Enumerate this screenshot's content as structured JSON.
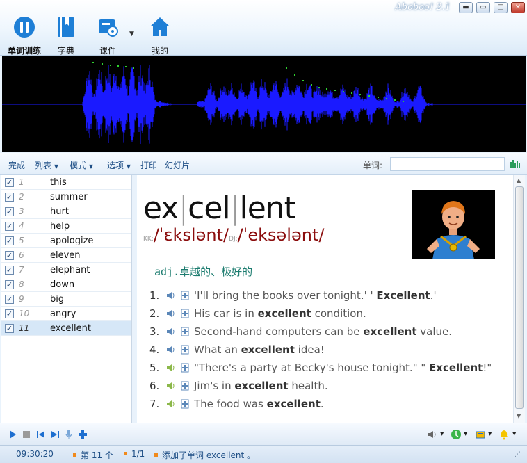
{
  "app": {
    "title": "Aboboo! 2.1"
  },
  "toolbar": {
    "buttons": [
      {
        "label": "单词训练",
        "icon": "pause-circle-icon"
      },
      {
        "label": "字典",
        "icon": "book-icon"
      },
      {
        "label": "课件",
        "icon": "courseware-icon"
      },
      {
        "label": "我的",
        "icon": "home-icon"
      }
    ]
  },
  "actionbar": {
    "done": "完成",
    "list": "列表",
    "mode": "模式",
    "options": "选项",
    "print": "打印",
    "slideshow": "幻灯片",
    "word_label": "单词:",
    "word_value": ""
  },
  "wordlist": {
    "items": [
      {
        "num": "1",
        "word": "this",
        "checked": true
      },
      {
        "num": "2",
        "word": "summer",
        "checked": true
      },
      {
        "num": "3",
        "word": "hurt",
        "checked": true
      },
      {
        "num": "4",
        "word": "help",
        "checked": true
      },
      {
        "num": "5",
        "word": "apologize",
        "checked": true
      },
      {
        "num": "6",
        "word": "eleven",
        "checked": true
      },
      {
        "num": "7",
        "word": "elephant",
        "checked": true
      },
      {
        "num": "8",
        "word": "down",
        "checked": true
      },
      {
        "num": "9",
        "word": "big",
        "checked": true
      },
      {
        "num": "10",
        "word": "angry",
        "checked": true
      },
      {
        "num": "11",
        "word": "excellent",
        "checked": true,
        "selected": true
      }
    ]
  },
  "entry": {
    "syllables": [
      "ex",
      "cel",
      "lent"
    ],
    "kk_tag": "KK:",
    "kk": "/ˈɛkslənt/",
    "dj_tag": "DJ:",
    "dj": "/ˈeksələnt/",
    "definition": "adj.卓越的、极好的",
    "examples": [
      {
        "num": "1.",
        "parts": [
          "'I'll bring the books over tonight.' ' ",
          "Excellent",
          ".'"
        ]
      },
      {
        "num": "2.",
        "parts": [
          "His car is in ",
          "excellent",
          " condition."
        ]
      },
      {
        "num": "3.",
        "parts": [
          "Second-hand computers can be ",
          "excellent",
          " value."
        ]
      },
      {
        "num": "4.",
        "parts": [
          "What an ",
          "excellent",
          " idea!"
        ]
      },
      {
        "num": "5.",
        "parts": [
          "\"There's a party at Becky's house tonight.\" \" ",
          "Excellent",
          "!\""
        ]
      },
      {
        "num": "6.",
        "parts": [
          "Jim's in ",
          "excellent",
          " health."
        ]
      },
      {
        "num": "7.",
        "parts": [
          "The food was ",
          "excellent",
          "."
        ]
      }
    ]
  },
  "status": {
    "clock": "09:30:20",
    "position": "第 11 个",
    "page": "1/1",
    "message": "添加了单词 excellent 。"
  },
  "colors": {
    "waveform": "#1a1aff",
    "phonetic": "#8b0d0d",
    "definition": "#1c7c6f",
    "accent": "#1f4f86"
  }
}
